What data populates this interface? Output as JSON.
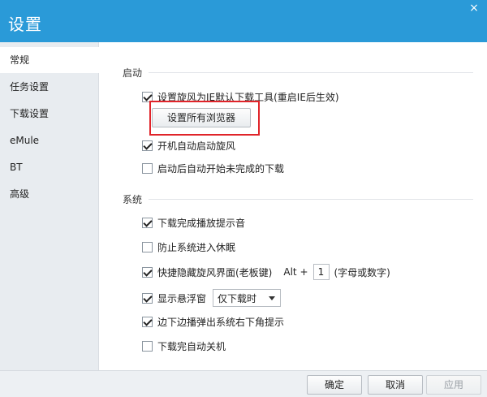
{
  "window": {
    "title": "设置",
    "close_icon": "×"
  },
  "sidebar": {
    "items": [
      {
        "label": "常规",
        "active": true
      },
      {
        "label": "任务设置"
      },
      {
        "label": "下载设置"
      },
      {
        "label": "eMule"
      },
      {
        "label": "BT"
      },
      {
        "label": "高级"
      }
    ]
  },
  "sections": {
    "startup": {
      "title": "启动",
      "options": [
        {
          "label": "设置旋风为IE默认下载工具(重启IE后生效)",
          "checked": true
        },
        {
          "label": "开机自动启动旋风",
          "checked": true
        },
        {
          "label": "启动后自动开始未完成的下载",
          "checked": false
        }
      ],
      "set_all_browsers_button": "设置所有浏览器"
    },
    "system": {
      "title": "系统",
      "options": [
        {
          "label": "下载完成播放提示音",
          "checked": true
        },
        {
          "label": "防止系统进入休眠",
          "checked": false
        },
        {
          "label": "快捷隐藏旋风界面(老板键)",
          "checked": true
        },
        {
          "label": "显示悬浮窗",
          "checked": true
        },
        {
          "label": "边下边播弹出系统右下角提示",
          "checked": true
        },
        {
          "label": "下载完自动关机",
          "checked": false
        }
      ],
      "hotkey": {
        "prefix": "Alt +",
        "value": "1",
        "hint": "(字母或数字)"
      },
      "float_window_select": {
        "value": "仅下载时"
      }
    }
  },
  "footer": {
    "ok": "确定",
    "cancel": "取消",
    "apply": "应用"
  },
  "colors": {
    "title_bar": "#2a9ad8",
    "highlight": "#e0242a"
  }
}
